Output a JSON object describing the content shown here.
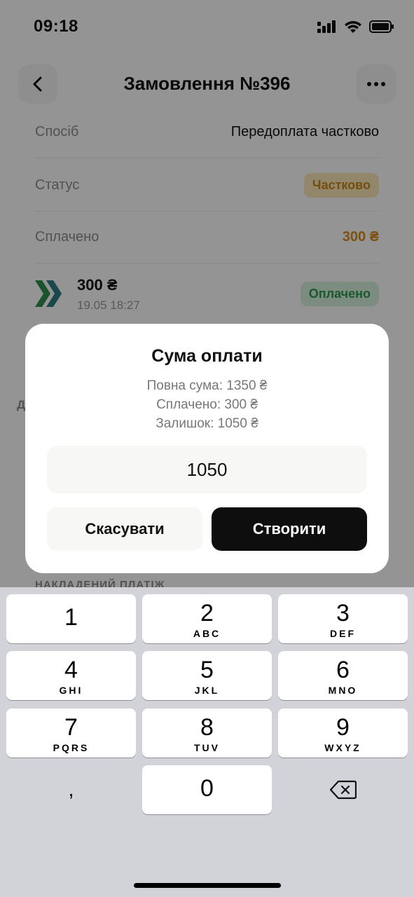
{
  "status_bar": {
    "time": "09:18",
    "icons": [
      "signal-icon",
      "wifi-icon",
      "battery-icon"
    ]
  },
  "header": {
    "title": "Замовлення №396",
    "back_icon": "chevron-left-icon",
    "more_icon": "more-horizontal-icon"
  },
  "details": {
    "method": {
      "label": "Спосіб",
      "value": "Передоплата частково"
    },
    "status": {
      "label": "Статус",
      "value": "Частково"
    },
    "paid": {
      "label": "Сплачено",
      "value": "300 ₴"
    }
  },
  "payment": {
    "amount": "300 ₴",
    "date": "19.05 18:27",
    "status": "Оплачено",
    "provider_icon": "double-chevron-logo-icon"
  },
  "background": {
    "side_glyph": "Д",
    "section_caption": "НАКЛАДЕНИЙ ПЛАТІЖ"
  },
  "modal": {
    "title": "Сума оплати",
    "total_line": "Повна сума: 1350 ₴",
    "paid_line": "Сплачено: 300 ₴",
    "remaining_line": "Залишок: 1050 ₴",
    "amount_value": "1050",
    "cancel_label": "Скасувати",
    "create_label": "Створити"
  },
  "keyboard": {
    "keys": [
      {
        "digit": "1",
        "letters": ""
      },
      {
        "digit": "2",
        "letters": "ABC"
      },
      {
        "digit": "3",
        "letters": "DEF"
      },
      {
        "digit": "4",
        "letters": "GHI"
      },
      {
        "digit": "5",
        "letters": "JKL"
      },
      {
        "digit": "6",
        "letters": "MNO"
      },
      {
        "digit": "7",
        "letters": "PQRS"
      },
      {
        "digit": "8",
        "letters": "TUV"
      },
      {
        "digit": "9",
        "letters": "WXYZ"
      }
    ],
    "comma": ",",
    "zero": "0",
    "delete_icon": "backspace-icon"
  },
  "colors": {
    "accent_dark": "#0e0e0e",
    "status_partial": "#c9861b",
    "status_paid": "#2e9a53",
    "keyboard_bg": "#d1d3d9"
  }
}
